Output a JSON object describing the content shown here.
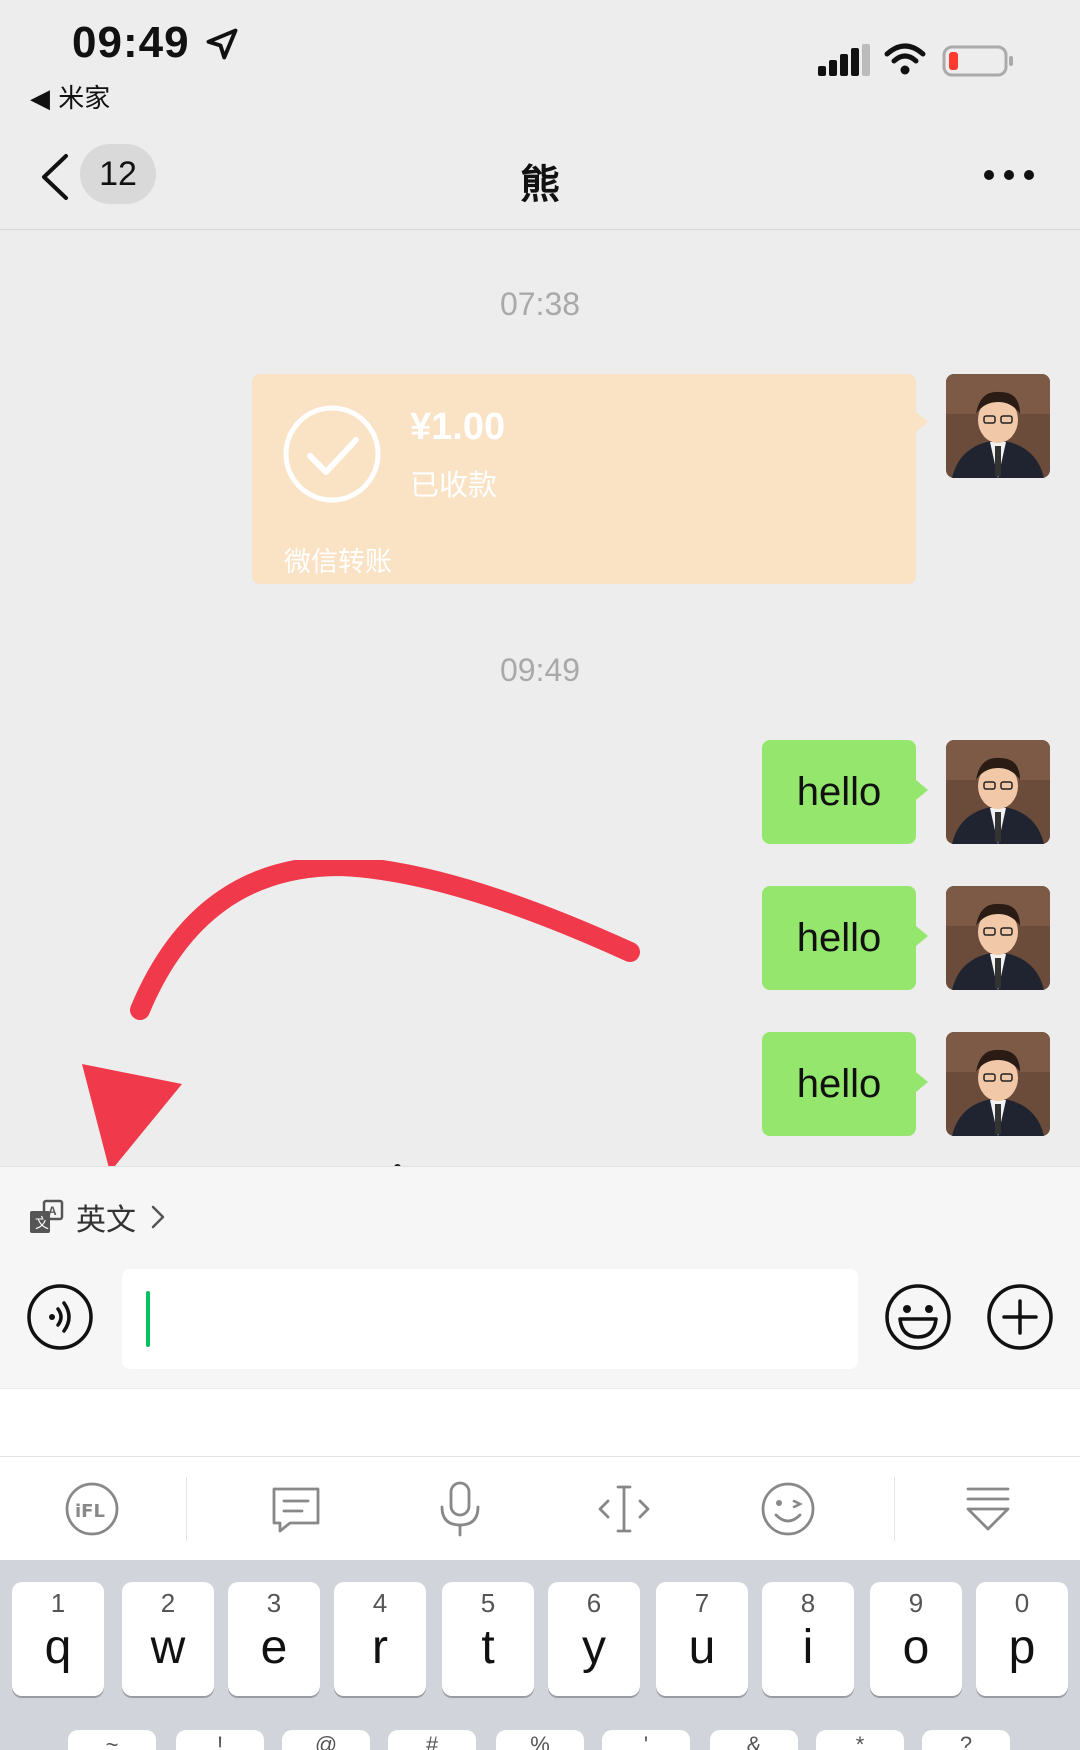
{
  "status_bar": {
    "time": "09:49",
    "back_app": "◀ 米家"
  },
  "nav": {
    "unread_count": "12",
    "title": "熊"
  },
  "messages": {
    "timestamp_1": "07:38",
    "transfer": {
      "amount": "¥1.00",
      "status": "已收款",
      "label": "微信转账"
    },
    "timestamp_2": "09:49",
    "bubbles": [
      "hello",
      "hello",
      "hello"
    ]
  },
  "input_area": {
    "translate_language": "英文"
  },
  "keyboard": {
    "keys": [
      {
        "num": "1",
        "letter": "q"
      },
      {
        "num": "2",
        "letter": "w"
      },
      {
        "num": "3",
        "letter": "e"
      },
      {
        "num": "4",
        "letter": "r"
      },
      {
        "num": "5",
        "letter": "t"
      },
      {
        "num": "6",
        "letter": "y"
      },
      {
        "num": "7",
        "letter": "u"
      },
      {
        "num": "8",
        "letter": "i"
      },
      {
        "num": "9",
        "letter": "o"
      },
      {
        "num": "0",
        "letter": "p"
      }
    ],
    "second_row_symbols": [
      "~",
      "!",
      "@",
      "#",
      "%",
      "'",
      "&",
      "*",
      "?"
    ]
  },
  "colors": {
    "bubble_green": "#95e66c",
    "transfer_orange": "#fae2c5",
    "annotation_red": "#f0394a",
    "caret_green": "#07c160"
  }
}
